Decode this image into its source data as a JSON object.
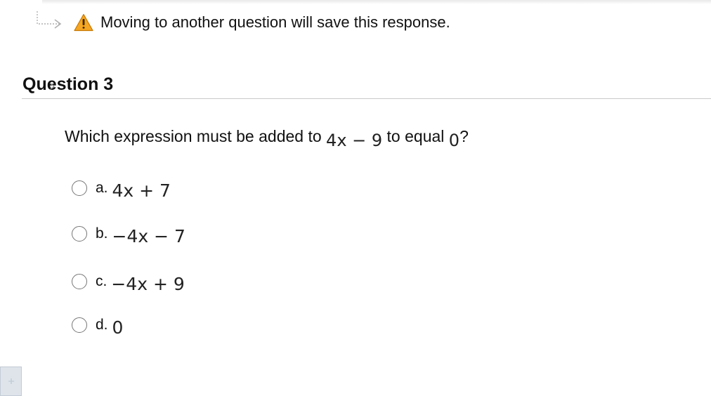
{
  "notice": {
    "text": "Moving to another question will save this response.",
    "icons": [
      "arrow-return-icon",
      "warning-icon"
    ],
    "warning_color": "#f5a623"
  },
  "question": {
    "title": "Question 3",
    "prompt_before": "Which expression must be added to",
    "prompt_expr": "4x − 9",
    "prompt_middle": "to equal",
    "prompt_value": "0",
    "prompt_end": "?",
    "options": [
      {
        "letter": "a.",
        "expr": "4x + 7"
      },
      {
        "letter": "b.",
        "expr": "−4x − 7"
      },
      {
        "letter": "c.",
        "expr": "−4x + 9"
      },
      {
        "letter": "d.",
        "expr": "0"
      }
    ],
    "selected": null
  },
  "sidebar_button": {
    "icon": "expand-icon"
  }
}
